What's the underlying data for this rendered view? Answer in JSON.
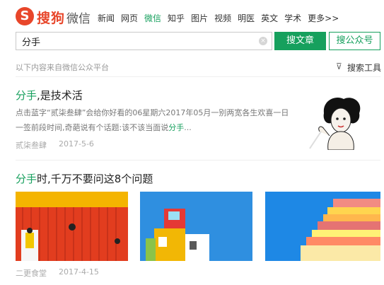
{
  "header": {
    "logo_char": "S",
    "logo_text": "搜狗",
    "logo_sub": "微信",
    "nav": [
      {
        "label": "新闻",
        "active": false
      },
      {
        "label": "网页",
        "active": false
      },
      {
        "label": "微信",
        "active": true
      },
      {
        "label": "知乎",
        "active": false
      },
      {
        "label": "图片",
        "active": false
      },
      {
        "label": "视频",
        "active": false
      },
      {
        "label": "明医",
        "active": false
      },
      {
        "label": "英文",
        "active": false
      },
      {
        "label": "学术",
        "active": false
      },
      {
        "label": "更多>>",
        "active": false
      }
    ]
  },
  "search": {
    "value": "分手",
    "clear_icon": "×",
    "btn_article": "搜文章",
    "btn_account": "搜公众号"
  },
  "toolbar": {
    "source_note": "以下内容来自微信公众平台",
    "filter_icon": "⊽",
    "tools_label": "搜索工具"
  },
  "results": [
    {
      "title_hl": "分手",
      "title_rest": ",是技术活",
      "summary_text": "点击蓝字“贰柒叁肆”会给你好看的06星期六2017年05月一别两宽各生欢喜一日一签前段时间,奇葩说有个话题:该不该当面说",
      "summary_hl": "分手",
      "summary_tail": "...",
      "source": "贰柒叁肆",
      "date": "2017-5-6"
    },
    {
      "title_hl": "分手",
      "title_rest": "时,千万不要问这8个问题",
      "source": "二更食堂",
      "date": "2017-4-15"
    }
  ],
  "colors": {
    "brand": "#e8462a",
    "accent": "#16a05d"
  }
}
